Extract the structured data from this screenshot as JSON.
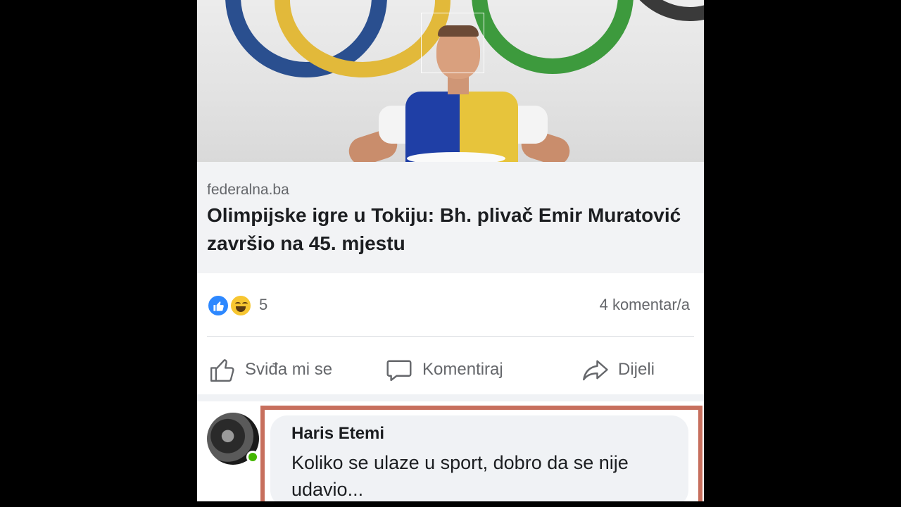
{
  "post": {
    "source": "federalna.ba",
    "headline": "Olimpijske igre u Tokiju: Bh. plivač Emir Muratović završio na 45. mjestu",
    "reaction_count": "5",
    "comment_count": "4 komentar/a",
    "reactions": [
      "like-icon",
      "haha-icon"
    ]
  },
  "actions": {
    "like_label": "Sviđa mi se",
    "comment_label": "Komentiraj",
    "share_label": "Dijeli"
  },
  "comment": {
    "author": "Haris Etemi",
    "text": "Koliko se ulaze u sport, dobro da se nije udavio..."
  },
  "colors": {
    "like_blue": "#2d88ff",
    "haha_yellow": "#f7c631",
    "highlight_border": "#c76f5d",
    "online_green": "#44b700"
  }
}
